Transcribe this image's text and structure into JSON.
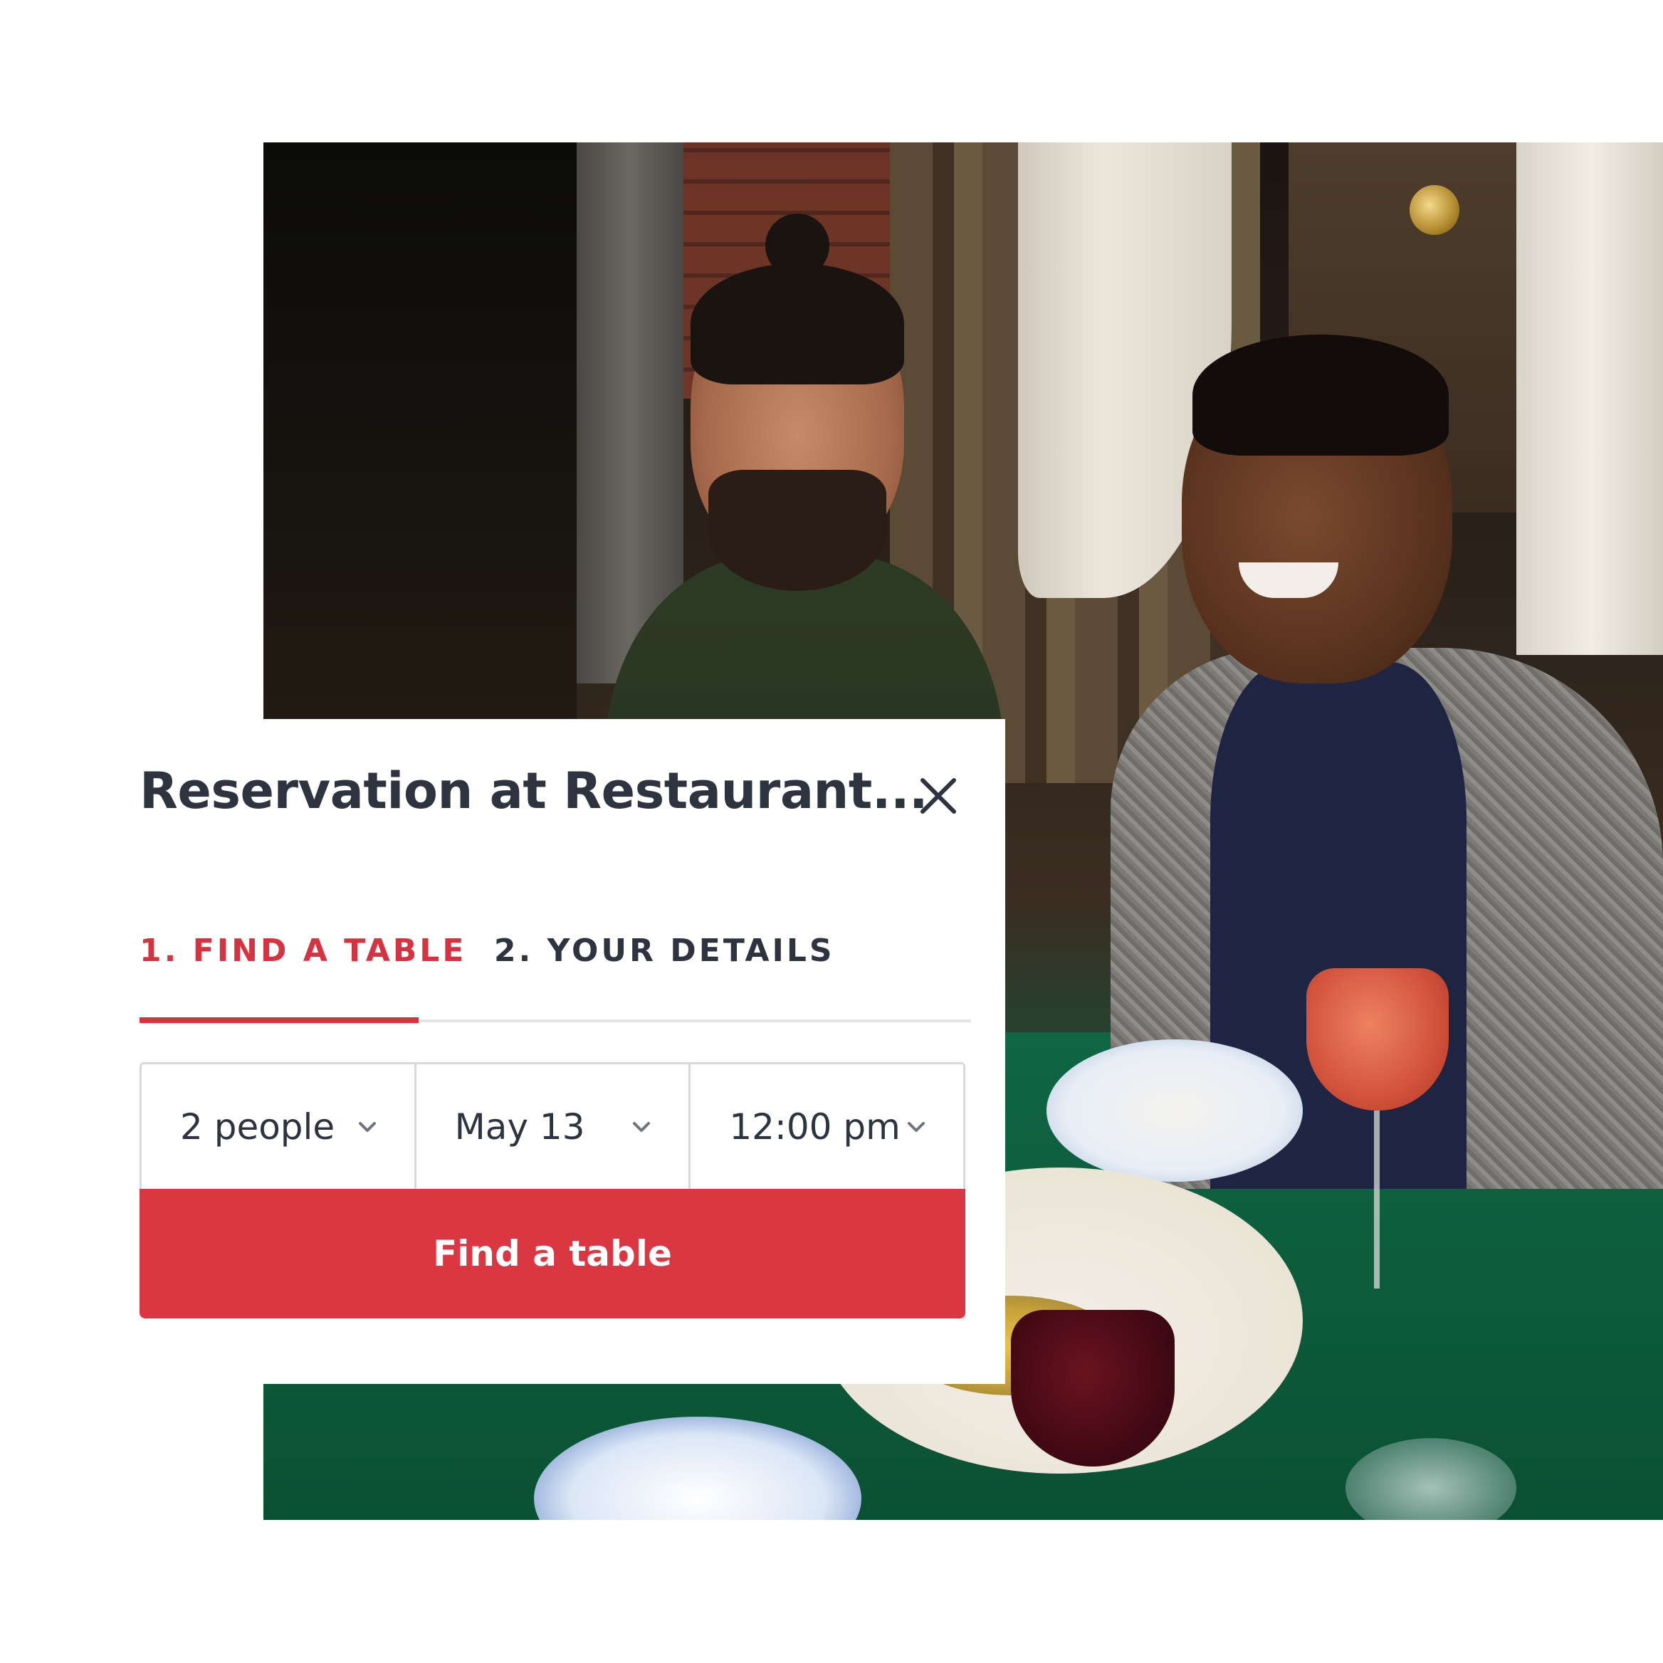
{
  "widget": {
    "title": "Reservation at Restaurant...",
    "tabs": {
      "find_label": "1. FIND A TABLE",
      "details_label": "2. YOUR DETAILS"
    },
    "selectors": {
      "party": "2 people",
      "date": "May 13",
      "time": "12:00 pm"
    },
    "submit_label": "Find a table"
  },
  "icons": {
    "close": "close-icon",
    "chevron": "chevron-down-icon"
  },
  "colors": {
    "accent": "#da3743",
    "active_tab": "#d6323f",
    "text": "#2d333f",
    "border": "#d8d9db"
  }
}
